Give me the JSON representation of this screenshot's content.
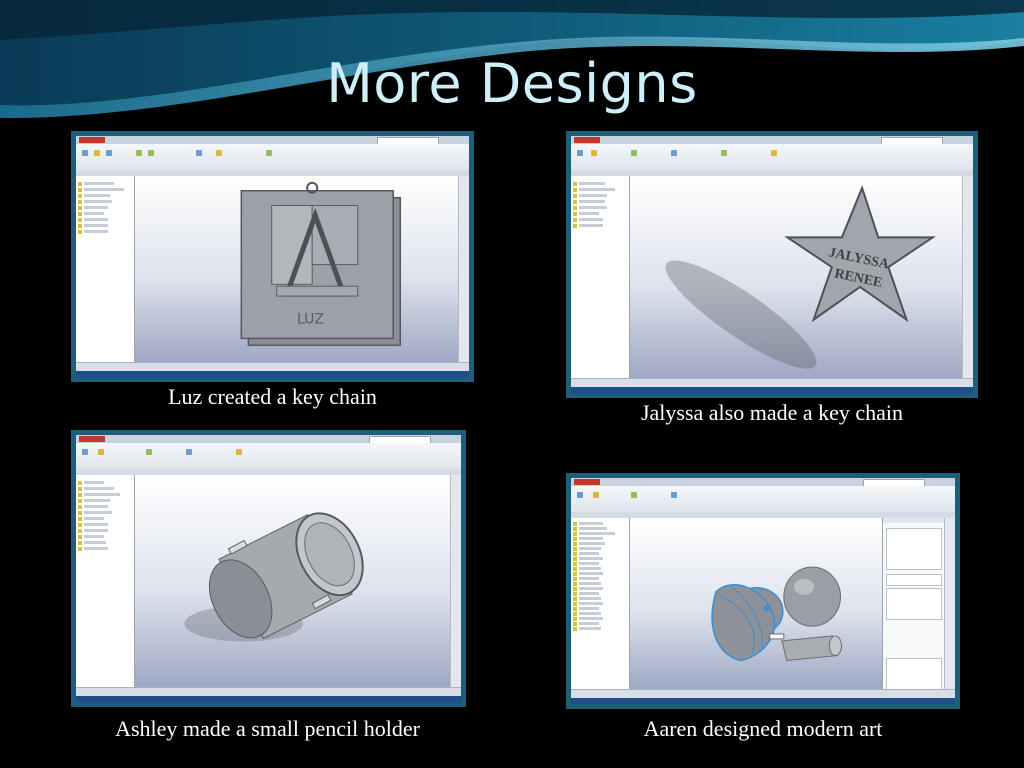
{
  "slide": {
    "title": "More Designs",
    "captions": {
      "luz": "Luz created a key chain",
      "jalyssa": "Jalyssa also made a key chain",
      "ashley": "Ashley made a small pencil holder",
      "aaren": "Aaren designed modern art"
    },
    "model_text": {
      "keychain_name": "LUZ",
      "star_line1": "JALYSSA",
      "star_line2": "RENEE"
    }
  },
  "colors": {
    "background": "#000000",
    "title": "#cfeef8",
    "frame": "#1d5f78",
    "caption": "#ffffff",
    "wave_dark": "#0b4f6b",
    "wave_light": "#2d8db0"
  }
}
